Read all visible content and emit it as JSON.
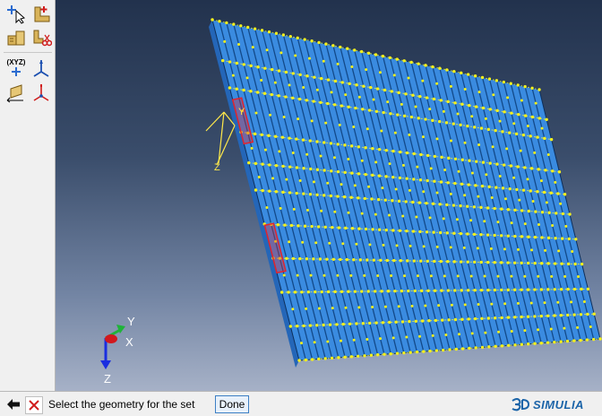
{
  "toolbox": {
    "items": [
      {
        "name": "query-icon"
      },
      {
        "name": "create-part-icon"
      },
      {
        "name": "part-manager-icon"
      },
      {
        "name": "cut-part-icon"
      },
      {
        "name": "datum-point-icon",
        "label": "(XYZ)"
      },
      {
        "name": "datum-axis-icon"
      },
      {
        "name": "datum-plane-icon"
      },
      {
        "name": "datum-csys-icon"
      }
    ]
  },
  "viewport": {
    "local_axes": {
      "y": "Y",
      "z": "Z"
    },
    "triad": {
      "x": "X",
      "y": "Y",
      "z": "Z"
    },
    "colors": {
      "part": "#3a8be0",
      "stripe": "#134a8a",
      "point": "#f5f01c",
      "highlight": "#e0242e",
      "axis_local": "#ffe94a"
    }
  },
  "prompt": {
    "text": "Select the geometry for the set",
    "done_label": "Done"
  },
  "logo": {
    "text": "SIMULIA"
  }
}
